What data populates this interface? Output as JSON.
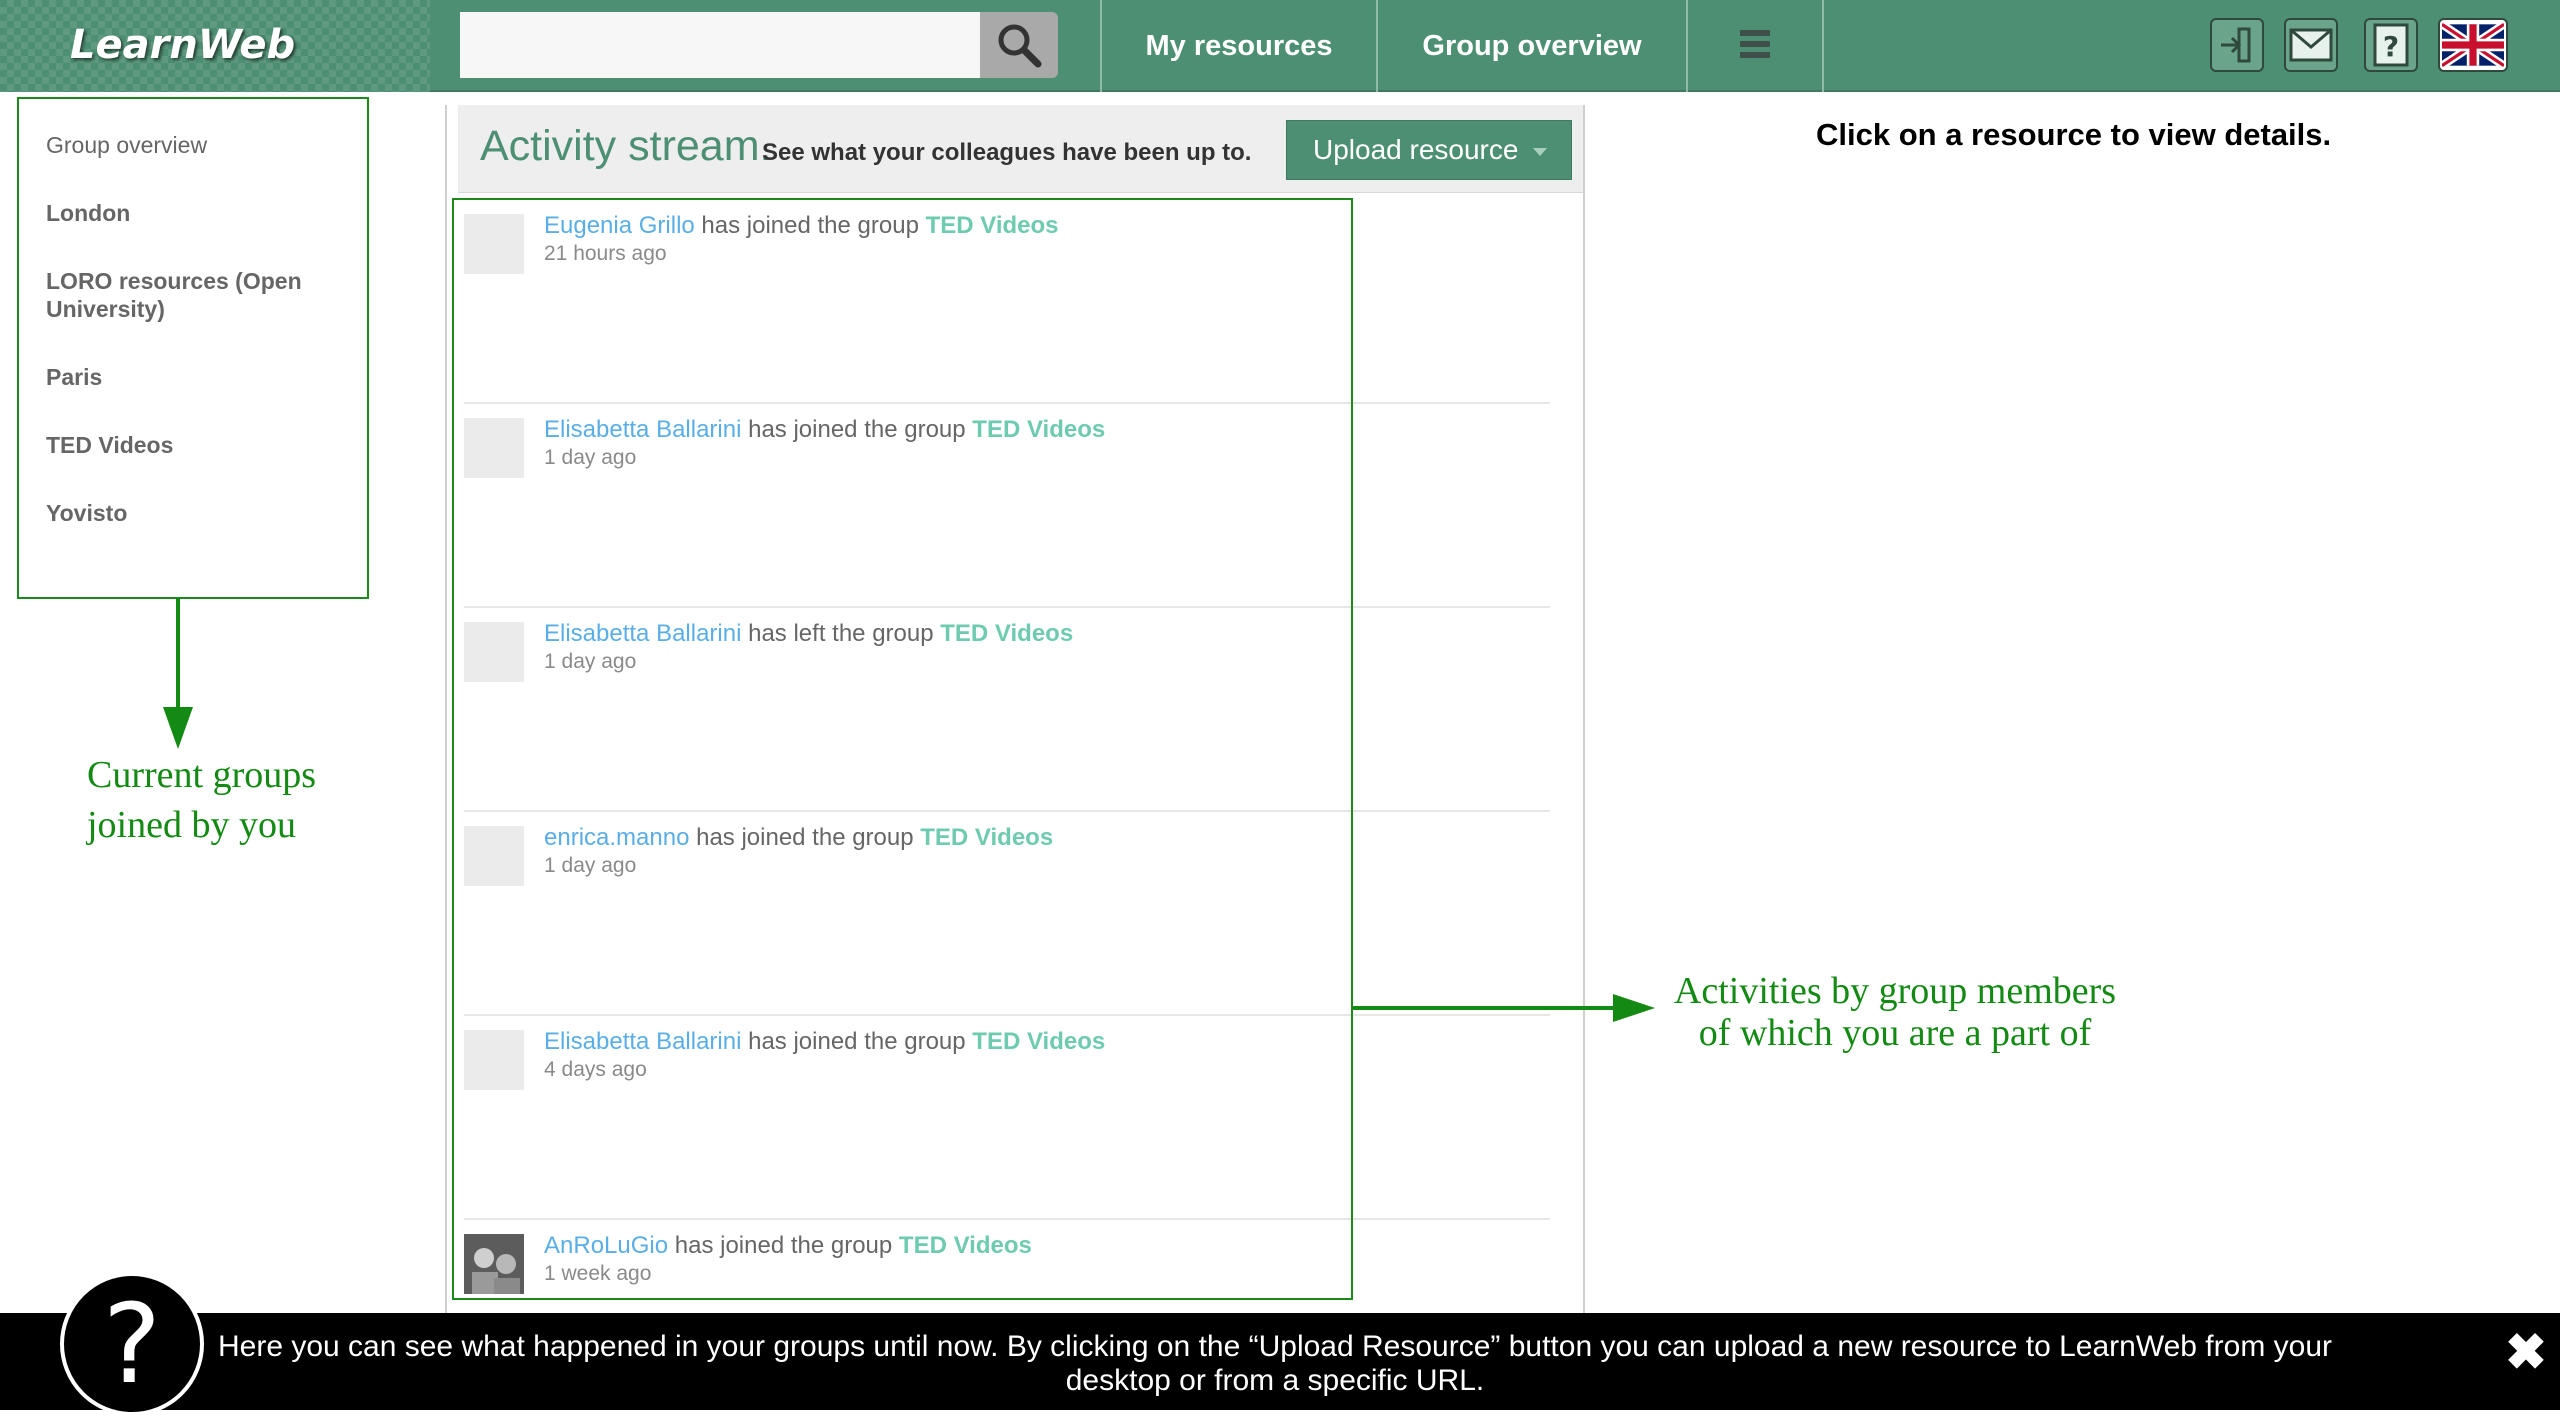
{
  "header": {
    "logo": "LearnWeb",
    "search": {
      "value": "",
      "placeholder": ""
    },
    "nav": {
      "my_resources": "My resources",
      "group_overview": "Group overview"
    },
    "icons": [
      "logout-icon",
      "mail-icon",
      "help-icon",
      "uk-flag-icon"
    ]
  },
  "sidebar": {
    "items": [
      {
        "label": "Group overview"
      },
      {
        "label": "London"
      },
      {
        "label": "LORO resources (Open University)"
      },
      {
        "label": "Paris"
      },
      {
        "label": "TED Videos"
      },
      {
        "label": "Yovisto"
      }
    ]
  },
  "activity": {
    "title": "Activity stream.",
    "subtitle": "See what your colleagues have been up to.",
    "upload_button": "Upload resource",
    "items": [
      {
        "user": "Eugenia Grillo",
        "action": "has joined the group",
        "group": "TED Videos",
        "time": "21 hours ago"
      },
      {
        "user": "Elisabetta Ballarini",
        "action": "has joined the group",
        "group": "TED Videos",
        "time": "1 day ago"
      },
      {
        "user": "Elisabetta Ballarini",
        "action": "has left the group",
        "group": "TED Videos",
        "time": "1 day ago"
      },
      {
        "user": "enrica.manno",
        "action": "has joined the group",
        "group": "TED Videos",
        "time": "1 day ago"
      },
      {
        "user": "Elisabetta Ballarini",
        "action": "has joined the group",
        "group": "TED Videos",
        "time": "4 days ago"
      },
      {
        "user": "AnRoLuGio",
        "action": "has joined the group",
        "group": "TED Videos",
        "time": "1 week ago"
      }
    ]
  },
  "hint": "Click on a resource to view details.",
  "annotations": {
    "groups": [
      "Current groups",
      "joined by you"
    ],
    "activities": [
      "Activities by group members",
      "of which you are a part of"
    ]
  },
  "tour": {
    "help_symbol": "?",
    "line1": "Here you can see what happened in your groups until now. By clicking on the “Upload Resource” button you can upload a new resource to LearnWeb from your",
    "line2": "desktop or from a specific URL.",
    "close": "✖"
  },
  "colors": {
    "brand": "#4d8f72",
    "annotation": "#138a13",
    "user_link": "#5aaee6",
    "group_link": "#6ecbb0"
  }
}
